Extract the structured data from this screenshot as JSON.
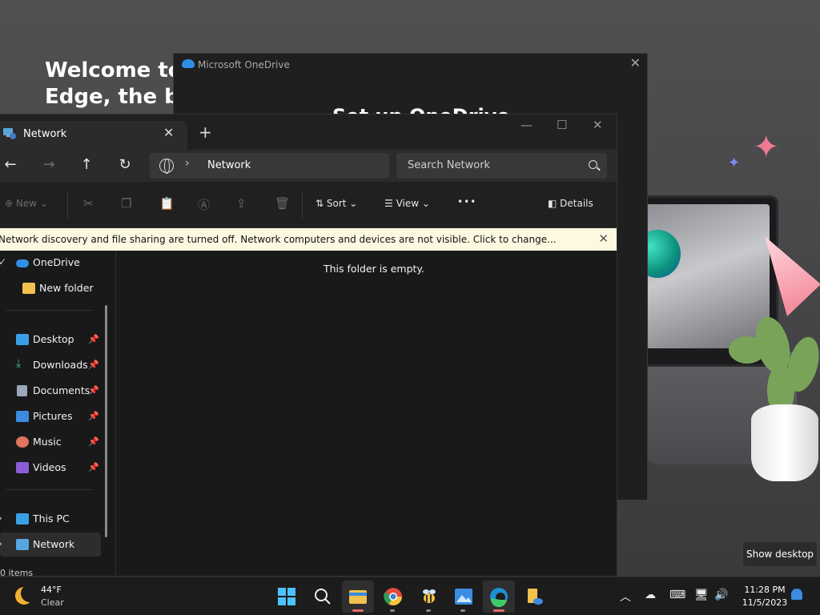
{
  "background": {
    "welcome_line1": "Welcome to",
    "welcome_line2": "Edge, the bes"
  },
  "onedrive": {
    "title": "Microsoft OneDrive",
    "heading": "Set up OneDrive"
  },
  "explorer": {
    "tab_label": "Network",
    "address": "Network",
    "search_placeholder": "Search Network",
    "toolbar": {
      "new": "New",
      "sort": "Sort",
      "view": "View",
      "more": "•••",
      "details": "Details"
    },
    "banner": "Network discovery and file sharing are turned off. Network computers and devices are not visible. Click to change...",
    "empty_message": "This folder is empty.",
    "status": "0 items",
    "nav": {
      "onedrive": "OneDrive",
      "new_folder": "New folder",
      "quick_access": [
        "Desktop",
        "Downloads",
        "Documents",
        "Pictures",
        "Music",
        "Videos"
      ],
      "this_pc": "This PC",
      "network": "Network"
    }
  },
  "tooltip": "Show desktop",
  "taskbar": {
    "temperature": "44°F",
    "condition": "Clear",
    "time": "11:28 PM",
    "date": "11/5/2023"
  },
  "colors": {
    "accent": "#3b8ce0",
    "banner": "#fdf9e1",
    "window_bg": "#191919"
  }
}
